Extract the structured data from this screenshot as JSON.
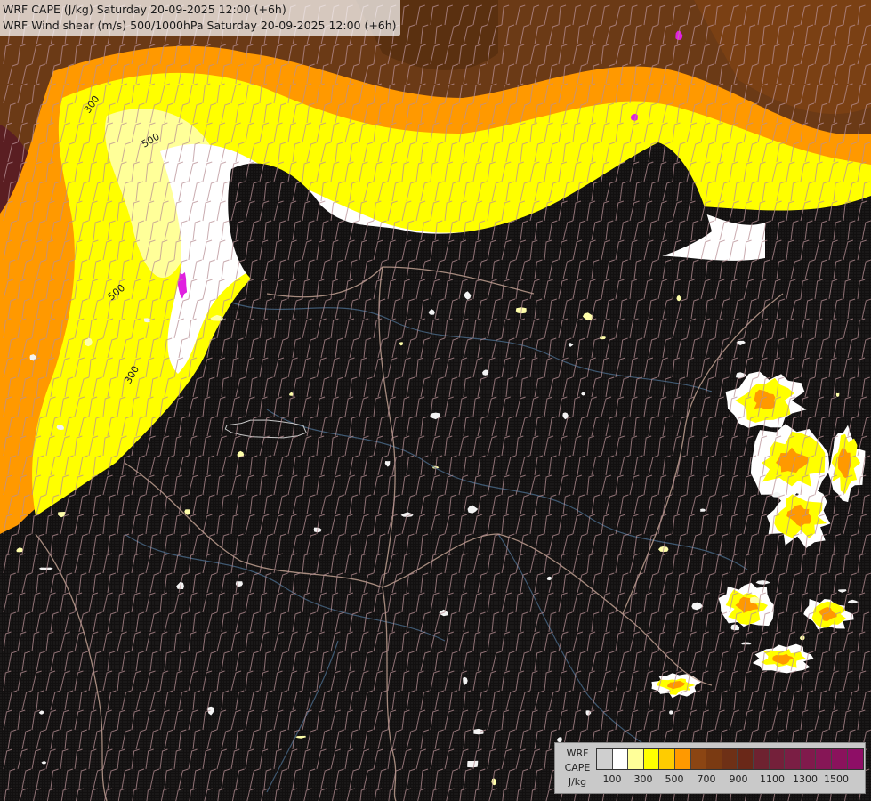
{
  "titles": {
    "line1": "WRF CAPE (J/kg) Saturday 20-09-2025 12:00 (+6h)",
    "line2": "WRF Wind shear (m/s) 500/1000hPa Saturday 20-09-2025 12:00 (+6h)"
  },
  "map_labels": {
    "contour_1": "300",
    "contour_2": "500",
    "contour_3": "500",
    "contour_4": "300"
  },
  "legend": {
    "label_line1": "WRF",
    "label_line2": "CAPE",
    "label_line3": "J/kg",
    "colors": [
      "#cfcfcf",
      "#ffffff",
      "#ffff99",
      "#ffff00",
      "#ffcc00",
      "#ff9900",
      "#8b4513",
      "#7a3a12",
      "#6e3016",
      "#6a2818",
      "#6e2230",
      "#74203a",
      "#7a1e44",
      "#801a4c",
      "#861656",
      "#8a125c",
      "#8e0e66"
    ],
    "tick_labels": [
      "100",
      "300",
      "500",
      "700",
      "900",
      "1100",
      "1300",
      "1500"
    ]
  },
  "colors": {
    "background": "#141210",
    "low_cape": "#ffffff",
    "mid_cape": "#ffff00",
    "orange_cape": "#ff9900",
    "brown_cape": "#6b3a16",
    "barbs": "#b89095",
    "borders": "#c0a090",
    "rivers": "#4a6a8a"
  }
}
